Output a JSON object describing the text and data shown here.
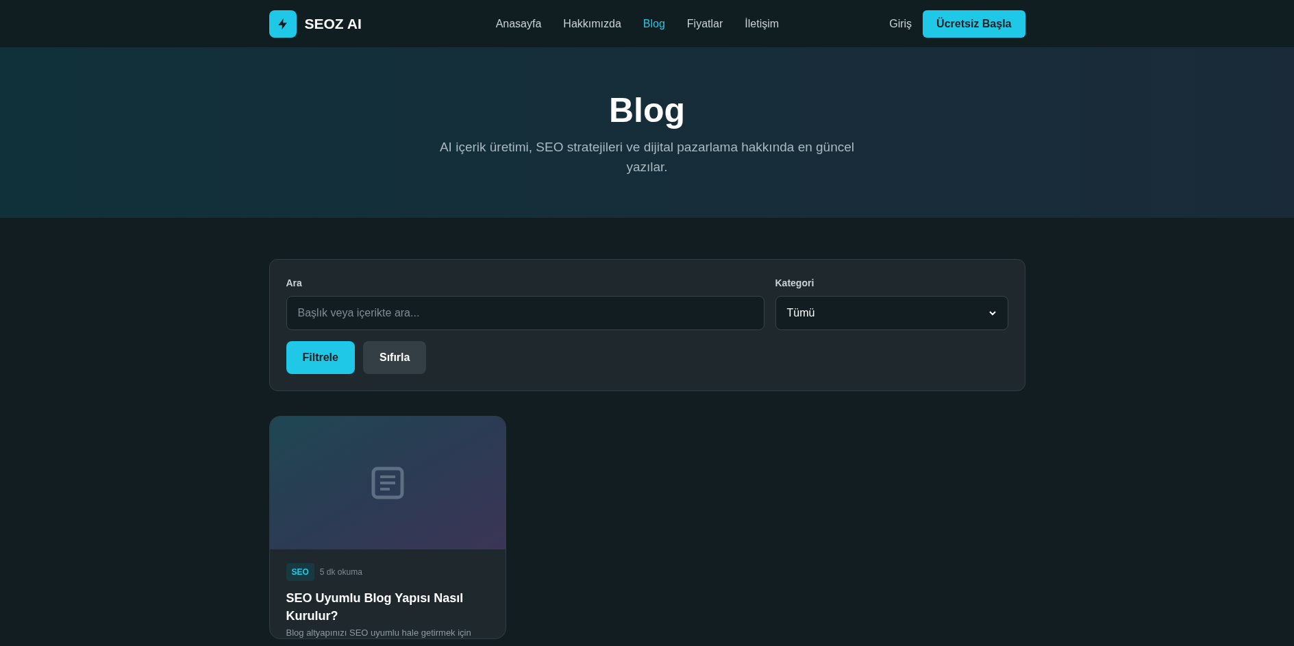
{
  "header": {
    "logo": "SEOZ AI",
    "nav": [
      {
        "label": "Anasayfa",
        "selected": false
      },
      {
        "label": "Hakkımızda",
        "selected": false
      },
      {
        "label": "Blog",
        "selected": true
      },
      {
        "label": "Fiyatlar",
        "selected": false
      },
      {
        "label": "İletişim",
        "selected": false
      }
    ],
    "login": "Giriş",
    "cta": "Ücretsiz Başla"
  },
  "hero": {
    "title": "Blog",
    "subtitle": "AI içerik üretimi, SEO stratejileri ve dijital pazarlama hakkında en güncel yazılar."
  },
  "filters": {
    "search_label": "Ara",
    "search_placeholder": "Başlık veya içerikte ara...",
    "category_label": "Kategori",
    "category_value": "Tümü",
    "filter_button": "Filtrele",
    "reset_button": "Sıfırla"
  },
  "posts": [
    {
      "category": "SEO",
      "read_time": "5 dk okuma",
      "title": "SEO Uyumlu Blog Yapısı Nasıl Kurulur?",
      "excerpt": "Blog altyapınızı SEO uyumlu hale getirmek için"
    }
  ]
}
